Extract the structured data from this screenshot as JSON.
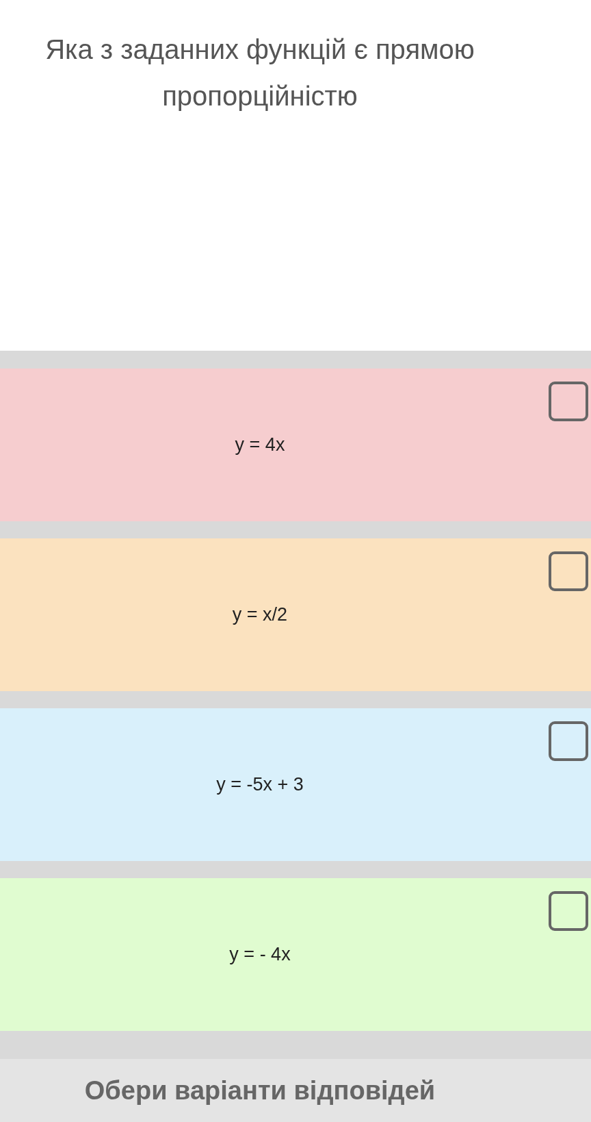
{
  "question": "Яка з заданних функцій є прямою пропорційністю",
  "options": [
    {
      "text": "y = 4x",
      "color": "#f6cdcf",
      "checked": false
    },
    {
      "text": "y = x/2",
      "color": "#fbe2bf",
      "checked": false
    },
    {
      "text": "y = -5x + 3",
      "color": "#d9f0fb",
      "checked": false
    },
    {
      "text": "y = - 4x",
      "color": "#e0fcd0",
      "checked": false
    }
  ],
  "submit_label": "Обери варіанти відповідей"
}
